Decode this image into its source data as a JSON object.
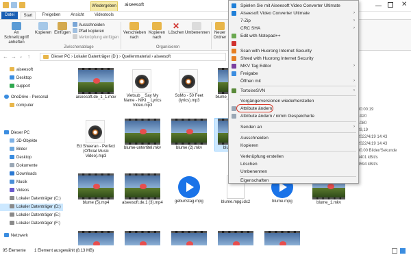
{
  "window": {
    "title": "aiseesoft",
    "contextual_tab": "Wiedergeben"
  },
  "ribbon_tabs": [
    "Datei",
    "Start",
    "Freigeben",
    "Ansicht",
    "Videotools"
  ],
  "ribbon": {
    "pin_label": "An Schnellzugriff anheften",
    "copy_label": "Kopieren",
    "paste_label": "Einfügen",
    "cut_label": "Ausschneiden",
    "copy_path_label": "Pfad kopieren",
    "paste_shortcut_label": "Verknüpfung einfügen",
    "clipboard_group": "Zwischenablage",
    "move_label": "Verschieben nach",
    "copyto_label": "Kopieren nach",
    "delete_label": "Löschen",
    "rename_label": "Umbenennen",
    "new_folder_label": "Neuer Ordner",
    "organize_group": "Organisieren"
  },
  "address": {
    "path": "Dieser PC  ›  Lokaler Datenträger (D:)  ›  Quellenmaterial  ›  aiseesoft"
  },
  "nav": {
    "items": [
      {
        "label": "aiseesoft",
        "icon": "folder-icon"
      },
      {
        "label": "Desktop",
        "icon": "desktop-icon"
      },
      {
        "label": "support",
        "icon": "folder-icon"
      },
      {
        "label": "OneDrive - Personal",
        "icon": "cloud-icon"
      },
      {
        "label": "computer",
        "icon": "folder-icon"
      },
      {
        "label": "Dieser PC",
        "icon": "pc-icon"
      },
      {
        "label": "3D-Objekte",
        "icon": "cube-icon"
      },
      {
        "label": "Bilder",
        "icon": "pictures-icon"
      },
      {
        "label": "Desktop",
        "icon": "desktop-icon"
      },
      {
        "label": "Dokumente",
        "icon": "documents-icon"
      },
      {
        "label": "Downloads",
        "icon": "download-icon"
      },
      {
        "label": "Musik",
        "icon": "music-icon"
      },
      {
        "label": "Videos",
        "icon": "video-icon"
      },
      {
        "label": "Lokaler Datenträger (C:)",
        "icon": "drive-icon"
      },
      {
        "label": "Lokaler Datenträger (D:)",
        "icon": "drive-icon"
      },
      {
        "label": "Lokaler Datenträger (E:)",
        "icon": "drive-icon"
      },
      {
        "label": "Lokaler Datenträger (F:)",
        "icon": "drive-icon"
      },
      {
        "label": "Netzwerk",
        "icon": "network-icon"
      }
    ]
  },
  "files": [
    {
      "name": "aiseesoft.de_1_1.mov",
      "kind": "video"
    },
    {
      "name": "Vietsub _ Say My Name - NIKI _ Lyrics Video.mp3",
      "kind": "audio"
    },
    {
      "name": "SoMo - 50 Feet (lyrics).mp3",
      "kind": "audio"
    },
    {
      "name": "blume_20220701.mkv",
      "kind": "video"
    },
    {
      "name": "Ed Sheeran - Perfect (Official Music Video).mp3",
      "kind": "audio"
    },
    {
      "name": "blume-untertitel.mkv",
      "kind": "video"
    },
    {
      "name": "blume (2).mkv",
      "kind": "video"
    },
    {
      "name": "blume_2.mp4",
      "kind": "video"
    },
    {
      "name": "blume (5).mp4",
      "kind": "video"
    },
    {
      "name": "aiseesoft.de.1 (3).mp4",
      "kind": "video"
    },
    {
      "name": "geburtstag.mpg",
      "kind": "play"
    },
    {
      "name": "blume.mpg.idx2",
      "kind": "doc"
    },
    {
      "name": "blume.mpg",
      "kind": "play"
    },
    {
      "name": "blume_1.mkv",
      "kind": "video"
    }
  ],
  "details": [
    "00:00:19",
    "1920",
    "1080",
    "29,19",
    "2022/4/19 14:43",
    "2022/4/19 14:43",
    "30.00 Bilder/Sekunde",
    "3401 kBit/s",
    "3594 kBit/s"
  ],
  "status": {
    "count": "95 Elemente",
    "selection": "1 Element ausgewählt (8.13 MB)"
  },
  "context_menu": {
    "items": [
      {
        "label": "Spielen Sie mit Aiseesoft Video Converter Ultimate",
        "icon": "aiseesoft-icon",
        "submenu": false
      },
      {
        "label": "Aiseesoft Video Converter Ultimate",
        "icon": "aiseesoft-icon",
        "submenu": true
      },
      {
        "label": "7-Zip",
        "icon": "",
        "submenu": true
      },
      {
        "label": "CRC SHA",
        "icon": "",
        "submenu": true
      },
      {
        "label": "Edit with Notepad++",
        "icon": "notepad-icon",
        "submenu": false
      },
      {
        "label": "",
        "icon": "",
        "submenu": false
      },
      {
        "label": "Scan with Huorong Internet Security",
        "icon": "huorong-icon",
        "submenu": false
      },
      {
        "label": "Shred with Huorong Internet Security",
        "icon": "huorong-icon",
        "submenu": false
      },
      {
        "label": "MKV Tag Editor",
        "icon": "mkv-icon",
        "submenu": true
      },
      {
        "label": "Freigabe",
        "icon": "share-icon",
        "submenu": false
      },
      {
        "label": "Öffnen mit",
        "icon": "",
        "submenu": true
      },
      {
        "label": "TortoiseSVN",
        "icon": "tortoise-icon",
        "submenu": true
      },
      {
        "label": "Vorgängerversionen wiederherstellen",
        "icon": "",
        "submenu": false
      },
      {
        "label": "Attribute ändern",
        "icon": "attribute-icon",
        "submenu": false
      },
      {
        "label": "Attribute ändern / nimm Gespeicherte",
        "icon": "attribute-icon",
        "submenu": false
      },
      {
        "label": "Senden an",
        "icon": "",
        "submenu": true
      },
      {
        "label": "Ausschneiden",
        "icon": "",
        "submenu": false
      },
      {
        "label": "Kopieren",
        "icon": "",
        "submenu": false
      },
      {
        "label": "Verknüpfung erstellen",
        "icon": "",
        "submenu": false
      },
      {
        "label": "Löschen",
        "icon": "",
        "submenu": false
      },
      {
        "label": "Umbenennen",
        "icon": "",
        "submenu": false
      },
      {
        "label": "Eigenschaften",
        "icon": "",
        "submenu": false
      }
    ]
  },
  "colors": {
    "accent": "#1a5fb4",
    "selection": "#cce8ff",
    "contextual_tab": "#f5e9a6",
    "highlight_ring": "#d93b2b"
  }
}
